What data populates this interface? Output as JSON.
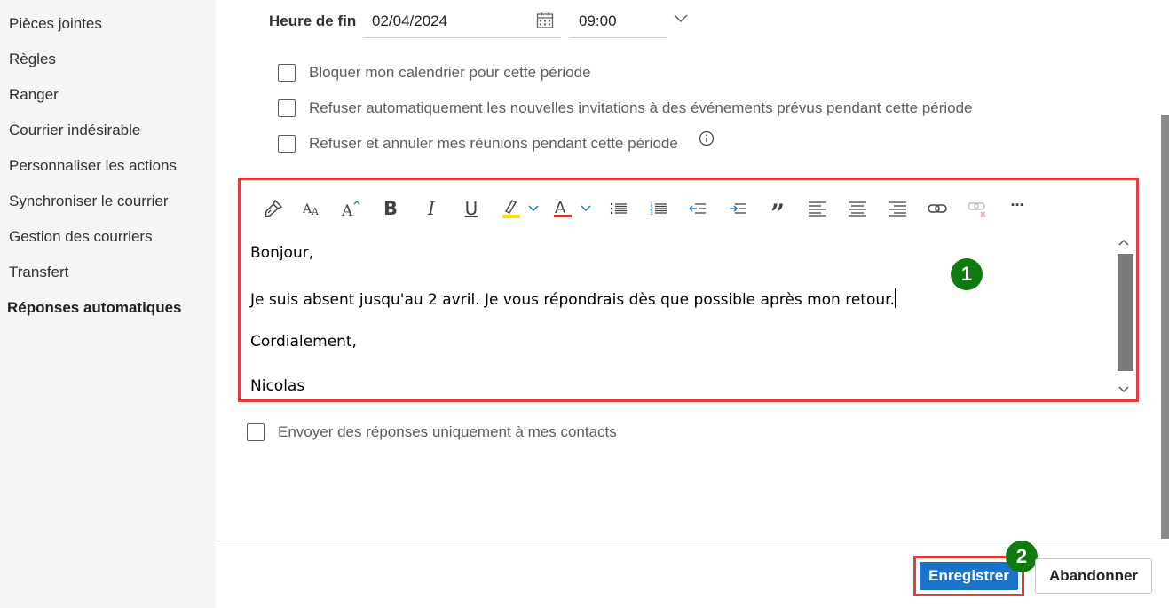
{
  "sidebar": {
    "items": [
      {
        "label": "Pièces jointes"
      },
      {
        "label": "Règles"
      },
      {
        "label": "Ranger"
      },
      {
        "label": "Courrier indésirable"
      },
      {
        "label": "Personnaliser les actions"
      },
      {
        "label": "Synchroniser le courrier"
      },
      {
        "label": "Gestion des courriers"
      },
      {
        "label": "Transfert"
      },
      {
        "label": "Réponses automatiques"
      }
    ],
    "active_index": 8
  },
  "end_time": {
    "label": "Heure de fin",
    "date_value": "02/04/2024",
    "time_value": "09:00"
  },
  "options": {
    "block_calendar": "Bloquer mon calendrier pour cette période",
    "decline_invites": "Refuser automatiquement les nouvelles invitations à des événements prévus pendant cette période",
    "decline_cancel": "Refuser et annuler mes réunions pendant cette période",
    "contacts_only": "Envoyer des réponses uniquement à mes contacts"
  },
  "toolbar": {
    "bold": "B",
    "italic": "I",
    "underline": "U",
    "quote": "”",
    "more": "···"
  },
  "message": {
    "line1": "Bonjour,",
    "line2": "Je suis absent jusqu'au 2 avril. Je vous répondrais dès que possible après mon retour.",
    "line3": "Cordialement,",
    "line4": "Nicolas"
  },
  "badges": {
    "one": "1",
    "two": "2"
  },
  "buttons": {
    "save": "Enregistrer",
    "discard": "Abandonner"
  },
  "colors": {
    "accent": "#1a73c9",
    "highlight": "#e03e3e",
    "badge": "#0f7b0f"
  }
}
